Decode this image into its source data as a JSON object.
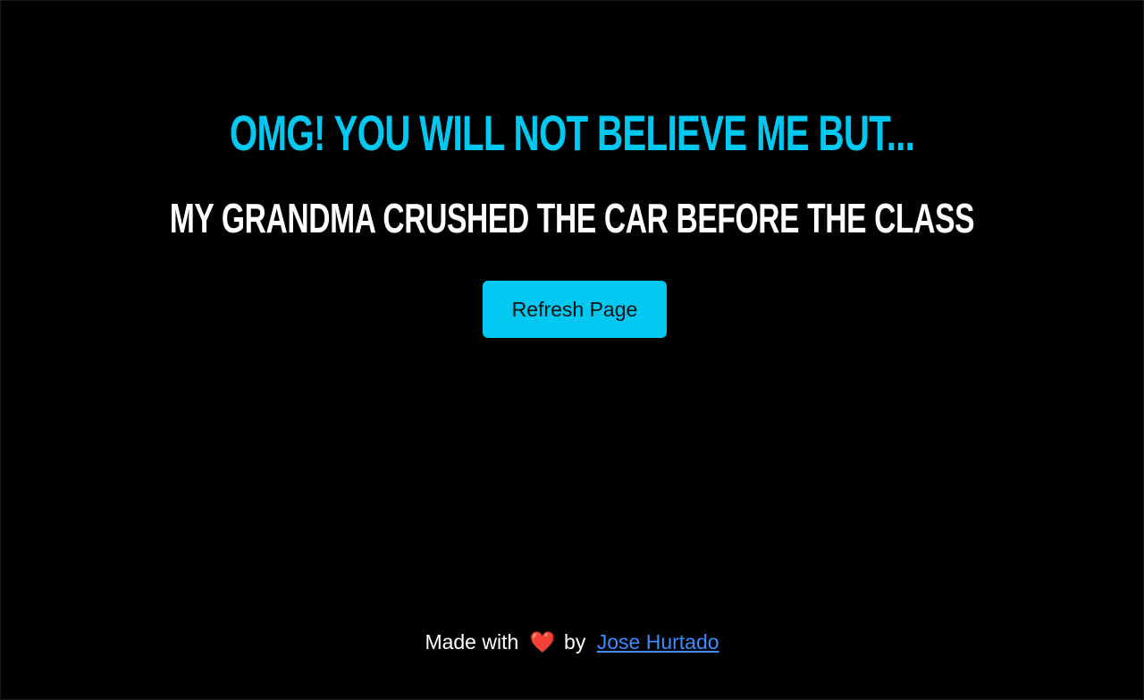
{
  "headline": {
    "text": "OMG! YOU WILL NOT BELIEVE ME BUT...",
    "color": "#00c8f0"
  },
  "excuse": {
    "text": "MY GRANDMA CRUSHED THE CAR BEFORE THE CLASS",
    "color": "#ffffff"
  },
  "refresh_button": {
    "label": "Refresh Page",
    "background": "#00c8f0"
  },
  "footer": {
    "prefix": "Made with",
    "heart_glyph": "❤️",
    "heart_icon": "heart-icon",
    "by_text": "by",
    "author_link": "Jose Hurtado",
    "link_color": "#3b8cff"
  }
}
